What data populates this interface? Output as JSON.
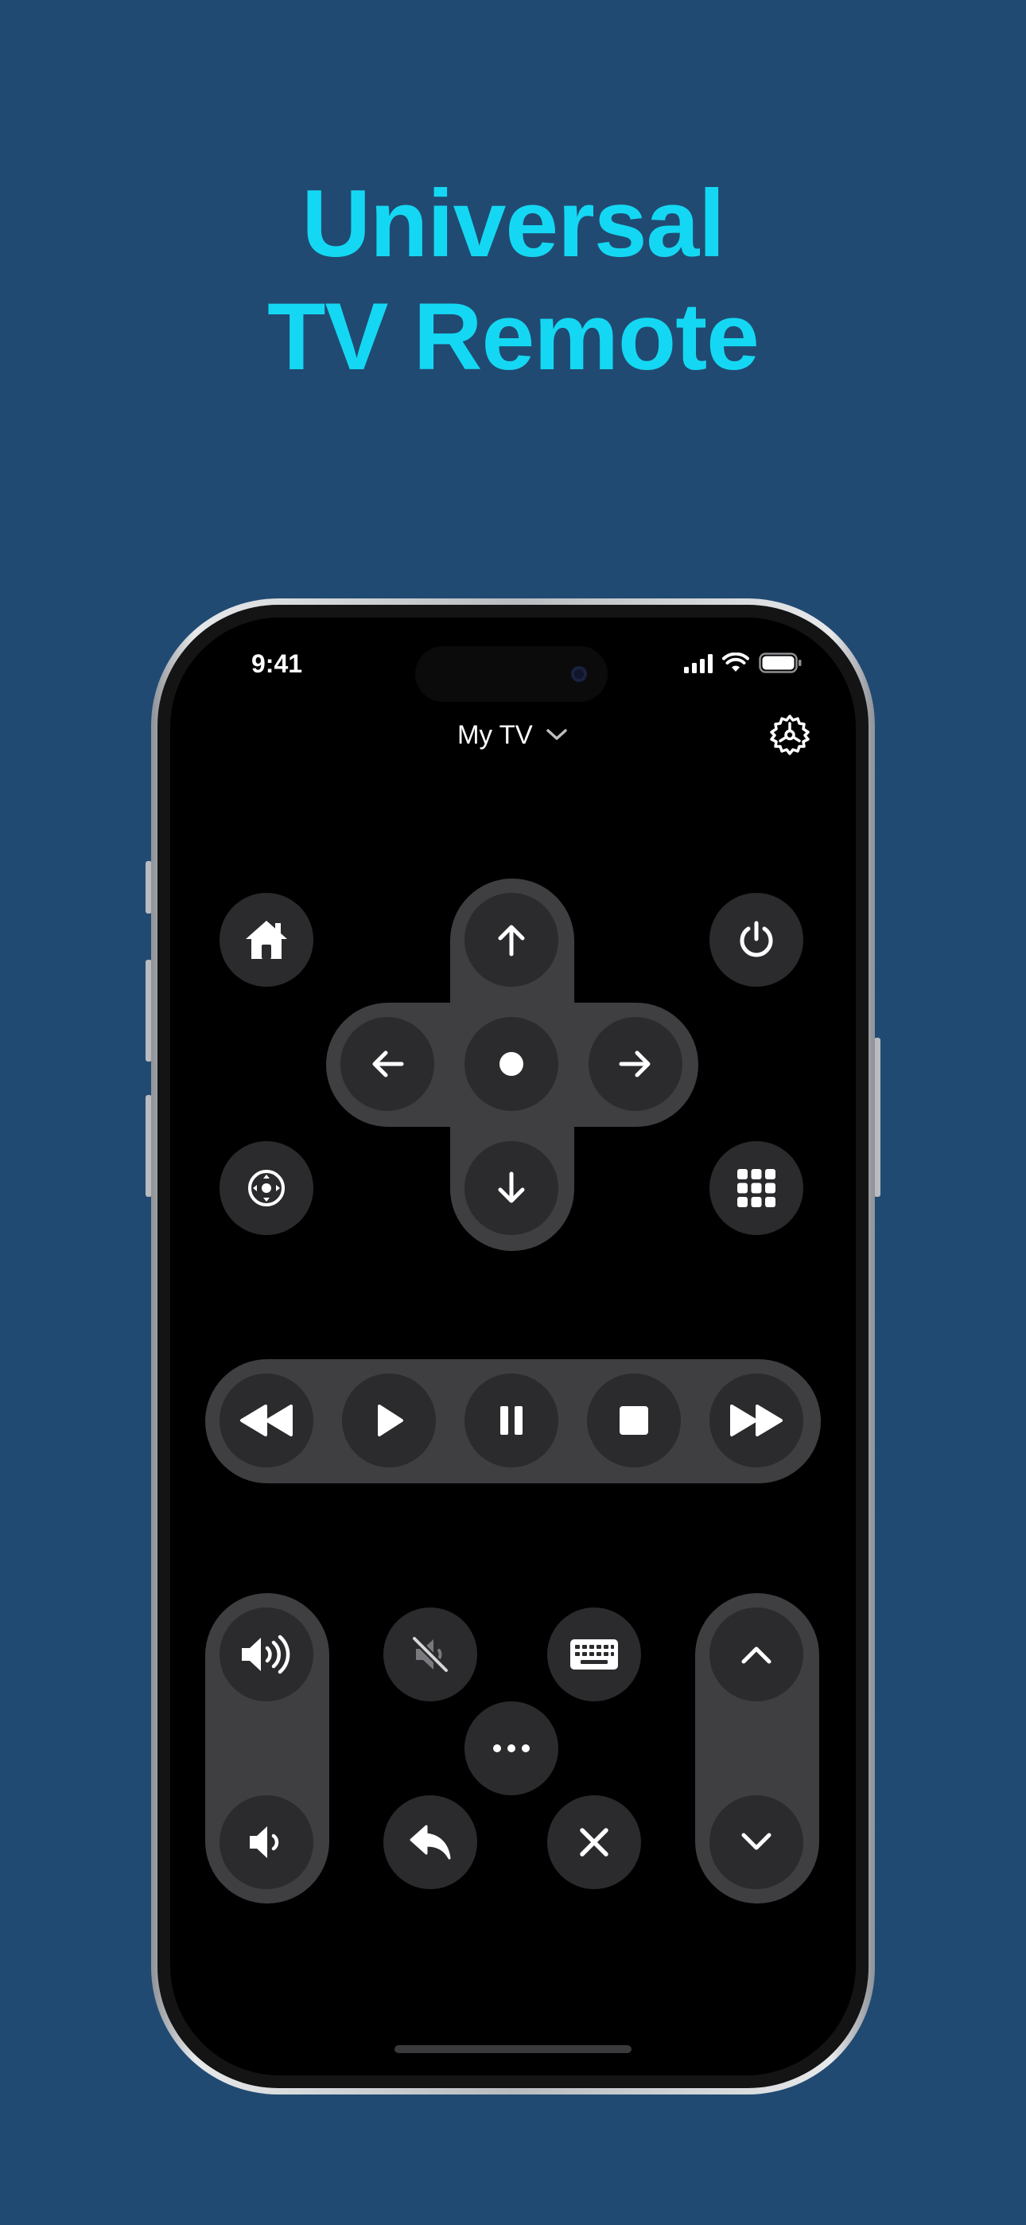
{
  "promo": {
    "headline_line1": "Universal",
    "headline_line2": "TV Remote",
    "headline_color": "#14d8f3",
    "background_color": "#214a72"
  },
  "status_bar": {
    "time": "9:41",
    "icons": [
      "cellular-signal-icon",
      "wifi-icon",
      "battery-icon"
    ]
  },
  "header": {
    "device_name": "My TV",
    "device_menu_icon": "chevron-down-icon",
    "settings_icon": "gear-icon"
  },
  "remote": {
    "top_buttons": [
      "home-icon",
      "power-icon",
      "source-icon",
      "app-grid-icon"
    ],
    "dpad": [
      "arrow-up-icon",
      "arrow-left-icon",
      "ok-dot-icon",
      "arrow-right-icon",
      "arrow-down-icon"
    ],
    "media": [
      "rewind-icon",
      "play-icon",
      "pause-icon",
      "stop-icon",
      "fast-forward-icon"
    ],
    "volume": [
      "volume-up-icon",
      "volume-down-icon"
    ],
    "channel": [
      "chevron-up-icon",
      "chevron-down-icon"
    ],
    "misc": [
      "mute-icon",
      "keyboard-icon",
      "more-icon",
      "back-icon",
      "close-icon"
    ]
  }
}
